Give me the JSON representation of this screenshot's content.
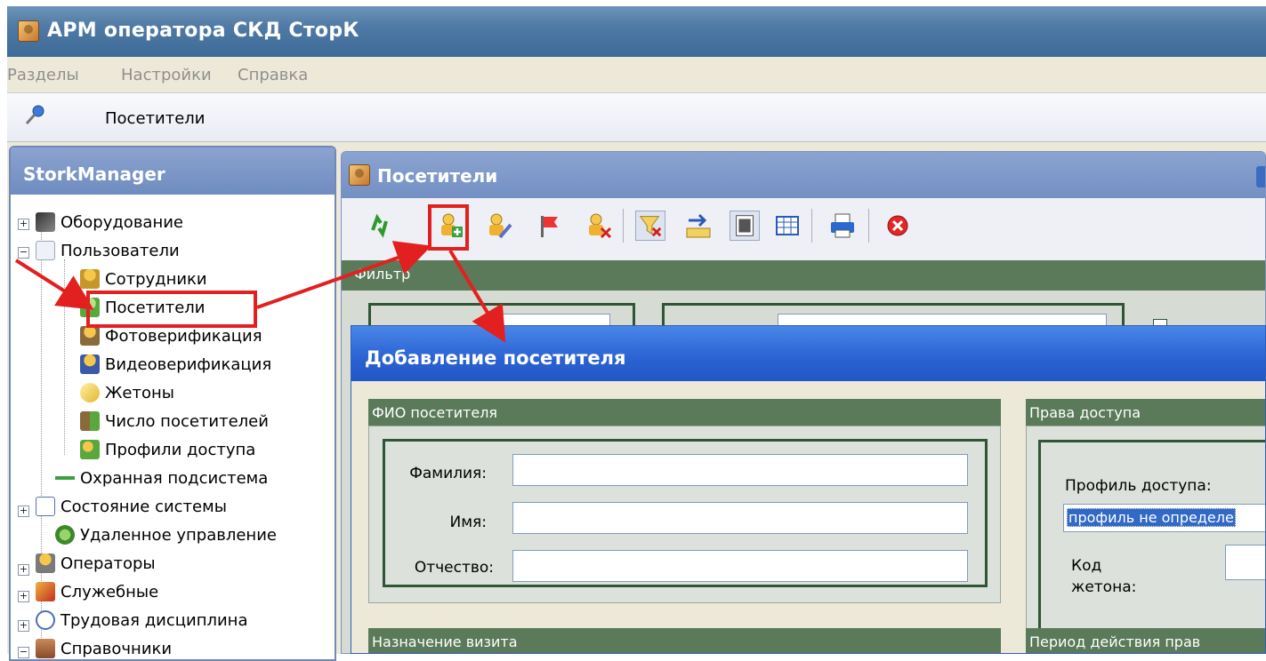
{
  "window": {
    "title": "АРМ оператора СКД СторК"
  },
  "menu": {
    "items": [
      "Разделы",
      "Настройки",
      "Справка"
    ]
  },
  "breadcrumb": {
    "label": "Посетители"
  },
  "left_panel": {
    "title": "StorkManager",
    "items": [
      {
        "label": "Оборудование"
      },
      {
        "label": "Пользователи"
      },
      {
        "label": "Сотрудники"
      },
      {
        "label": "Посетители"
      },
      {
        "label": "Фотоверификация"
      },
      {
        "label": "Видеоверификация"
      },
      {
        "label": "Жетоны"
      },
      {
        "label": "Число посетителей"
      },
      {
        "label": "Профили доступа"
      },
      {
        "label": "Охранная подсистема"
      },
      {
        "label": "Состояние системы"
      },
      {
        "label": "Удаленное управление"
      },
      {
        "label": "Операторы"
      },
      {
        "label": "Служебные"
      },
      {
        "label": "Трудовая дисциплина"
      },
      {
        "label": "Справочники"
      }
    ]
  },
  "visitors_window": {
    "title": "Посетители",
    "filter_label": "Фильтр",
    "toolbar_icons": [
      "refresh-icon",
      "add-visitor-icon",
      "edit-visitor-icon",
      "flag-icon",
      "delete-visitor-icon",
      "filter-off-icon",
      "import-icon",
      "card-view-icon",
      "table-view-icon",
      "print-icon",
      "close-icon"
    ]
  },
  "dialog": {
    "title": "Добавление посетителя",
    "fio_group": "ФИО посетителя",
    "surname_label": "Фамилия:",
    "name_label": "Имя:",
    "patronymic_label": "Отчество:",
    "surname_value": "",
    "name_value": "",
    "patronymic_value": "",
    "rights_group": "Права доступа",
    "profile_label": "Профиль доступа:",
    "profile_value": "профиль не определе",
    "token_label_1": "Код",
    "token_label_2": "жетона:",
    "token_value": "",
    "visit_group": "Назначение визита",
    "period_group": "Период действия прав"
  },
  "colors": {
    "annotation_red": "#e32020",
    "group_header_green": "#5a7a59",
    "dialog_title_blue": "#2a62d2"
  }
}
